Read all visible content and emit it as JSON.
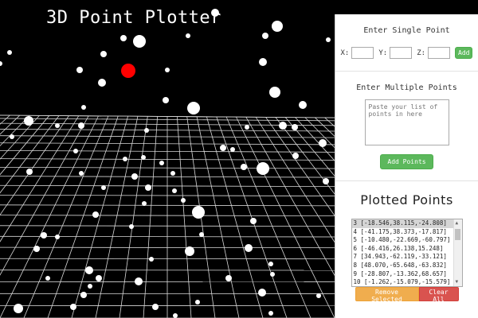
{
  "app": {
    "title": "3D Point Plotter"
  },
  "single": {
    "title": "Enter Single Point",
    "x_label": "X:",
    "y_label": "Y:",
    "z_label": "Z:",
    "x_value": "",
    "y_value": "",
    "z_value": "",
    "add_label": "Add"
  },
  "multi": {
    "title": "Enter Multiple Points",
    "placeholder": "Paste your list of points in here",
    "button_label": "Add Points"
  },
  "plotted": {
    "title": "Plotted Points",
    "items": [
      "3 [-18.546,38.115,-24.808]",
      "4 [-41.175,38.373,-17.817]",
      "5 [-10.480,-22.669,-60.797]",
      "6 [-46.416,26.138,15.248]",
      "7 [34.943,-62.119,-33.121]",
      "8 [48.070,-65.648,-63.832]",
      "9 [-28.807,-13.362,68.657]",
      "10 [-1.262,-15.079,-15.579]"
    ],
    "selected_index": 0,
    "remove_label": "Remove Selected",
    "clear_label": "Clear All"
  },
  "colors": {
    "point": "#ffffff",
    "highlight": "#ff0000",
    "grid": "#d8d8d8"
  }
}
